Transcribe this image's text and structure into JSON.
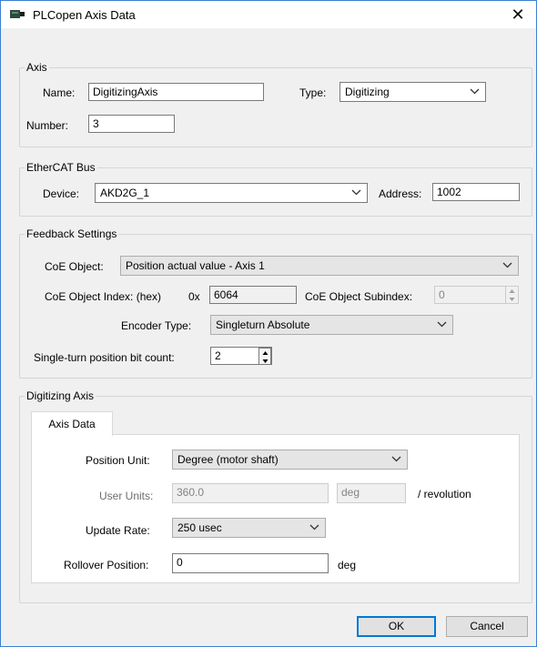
{
  "window": {
    "title": "PLCopen Axis Data",
    "close_glyph": "✕"
  },
  "axis": {
    "legend": "Axis",
    "name_label": "Name:",
    "name_value": "DigitizingAxis",
    "type_label": "Type:",
    "type_value": "Digitizing",
    "number_label": "Number:",
    "number_value": "3"
  },
  "bus": {
    "legend": "EtherCAT Bus",
    "device_label": "Device:",
    "device_value": "AKD2G_1",
    "address_label": "Address:",
    "address_value": "1002"
  },
  "feedback": {
    "legend": "Feedback Settings",
    "coe_object_label": "CoE Object:",
    "coe_object_value": "Position actual value - Axis 1",
    "index_label": "CoE Object Index: (hex)",
    "hex_prefix": "0x",
    "index_value": "6064",
    "subindex_label": "CoE Object Subindex:",
    "subindex_value": "0",
    "encoder_label": "Encoder Type:",
    "encoder_value": "Singleturn Absolute",
    "bitcount_label": "Single-turn position bit count:",
    "bitcount_value": "2"
  },
  "digitizing": {
    "legend": "Digitizing Axis",
    "tab_label": "Axis Data",
    "position_unit_label": "Position Unit:",
    "position_unit_value": "Degree (motor shaft)",
    "user_units_label": "User Units:",
    "user_units_value": "360.0",
    "user_units_unit": "deg",
    "per_revolution": "/ revolution",
    "update_rate_label": "Update Rate:",
    "update_rate_value": "250 usec",
    "rollover_label": "Rollover Position:",
    "rollover_value": "0",
    "rollover_unit": "deg"
  },
  "buttons": {
    "ok": "OK",
    "cancel": "Cancel"
  },
  "icons": {
    "app": "plcopen-axis-icon",
    "close": "close-icon",
    "dropdown": "chevron-down-icon",
    "spinner": "spinner-arrows-icon"
  }
}
